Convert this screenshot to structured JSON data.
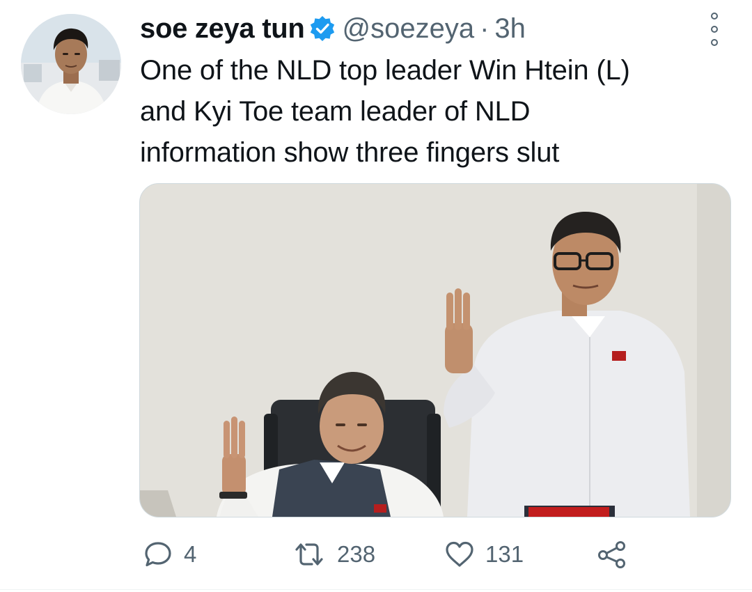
{
  "tweet": {
    "display_name": "soe zeya tun",
    "verified": true,
    "handle": "@soezeya",
    "separator": "·",
    "time": "3h",
    "text_lines": [
      "One of the NLD top leader Win Htein (L)",
      "and Kyi Toe team leader of NLD",
      "information show three fingers slut"
    ],
    "avatar_icon": "profile-photo",
    "media_icon": "photo",
    "actions": {
      "reply": {
        "icon": "reply-icon",
        "count": "4"
      },
      "retweet": {
        "icon": "retweet-icon",
        "count": "238"
      },
      "like": {
        "icon": "heart-icon",
        "count": "131"
      },
      "share": {
        "icon": "share-icon"
      }
    }
  },
  "colors": {
    "text_primary": "#0f1419",
    "text_secondary": "#536471",
    "verified_blue": "#1d9bf0",
    "background": "#ffffff"
  }
}
